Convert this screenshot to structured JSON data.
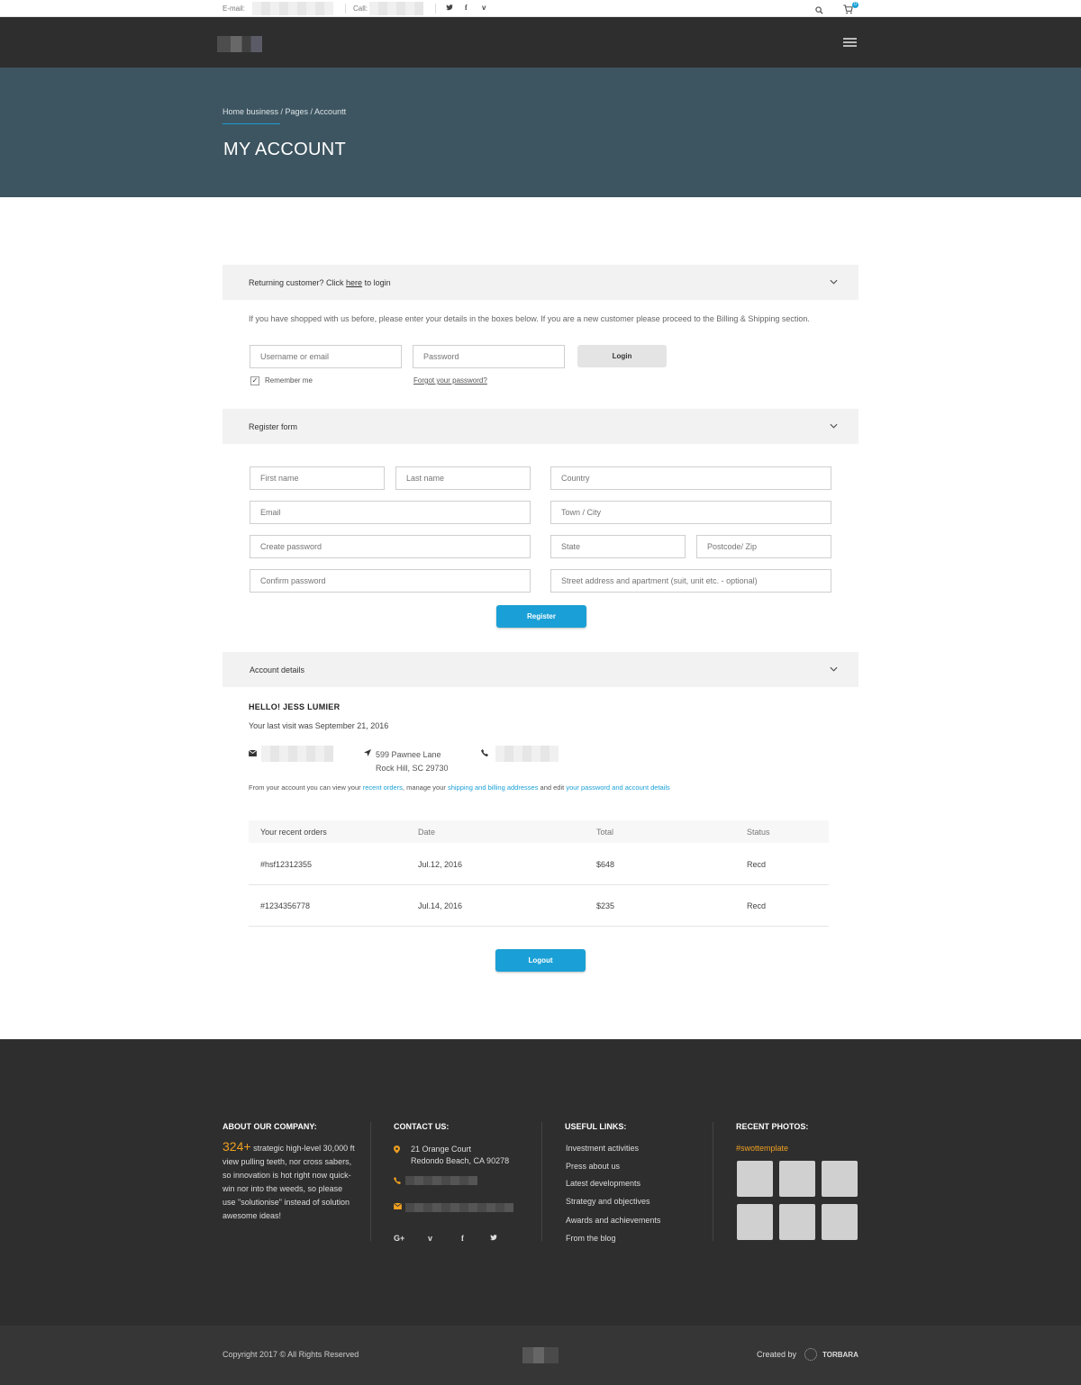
{
  "topbar": {
    "email_label": "E-mail:",
    "call_label": "Call:",
    "social": [
      "twitter-icon",
      "facebook-icon",
      "vimeo-icon"
    ],
    "cart_count": "0"
  },
  "title_band": {
    "breadcrumb": "Home business / Pages / Accountt",
    "title": "MY ACCOUNT"
  },
  "login_section": {
    "header_prefix": "Returning customer?  Click ",
    "header_link": "here",
    "header_suffix": " to login",
    "note": "If you have shopped with us before, please enter your details in the boxes below. If you are a new customer please proceed to the Billing & Shipping section.",
    "username_placeholder": "Username or email",
    "password_placeholder": "Password",
    "login_button": "Login",
    "remember_me": "Remember me",
    "forgot": "Forgot your password?"
  },
  "register_section": {
    "title": "Register form",
    "first_name": "First name",
    "last_name": "Last name",
    "email": "Email",
    "create_password": "Create password",
    "confirm_password": "Confirm password",
    "country": "Country",
    "town": "Town / City",
    "state": "State",
    "postcode": "Postcode/ Zip",
    "street": "Street address and apartment (suit, unit etc. - optional)",
    "register_button": "Register"
  },
  "account_section": {
    "title": "Account details",
    "hello": "HELLO!  JESS LUMIER",
    "last_visit": "Your last visit was September 21, 2016",
    "address_line1": "599 Pawnee Lane",
    "address_line2": "Rock Hill, SC 29730",
    "text_1": "From your account you can view your ",
    "link_1": "recent orders",
    "text_2": ", manage your ",
    "link_2": "shipping and billing addresses",
    "text_3": " and edit ",
    "link_3": "your password and account details",
    "orders_headers": [
      "Your recent orders",
      "Date",
      "Total",
      "Status"
    ],
    "orders": [
      {
        "id": "#hsf12312355",
        "date": "Jul.12, 2016",
        "total": "$648",
        "status": "Recd"
      },
      {
        "id": "#1234356778",
        "date": "Jul.14, 2016",
        "total": "$235",
        "status": "Recd"
      }
    ],
    "logout_button": "Logout"
  },
  "footer": {
    "about_title": "ABOUT OUR COMPANY:",
    "about_number": "324+",
    "about_text_1": "strategic high-level",
    "about_text_2": "30,000 ft view pulling teeth, nor cross sabers, so innovation is hot right now quick-win nor into the weeds, so please use \"solutionise\" instead of solution awesome ideas!",
    "contact_title": "CONTACT US:",
    "contact_address_1": "21 Orange Court",
    "contact_address_2": "Redondo Beach, CA 90278",
    "links_title": "USEFUL LINKS:",
    "links": [
      "Investment activities",
      "Press about us",
      "Latest developments",
      "Strategy and objectives",
      "Awards and achievements",
      "From the blog"
    ],
    "photos_title": "RECENT PHOTOS:",
    "photos_tag": "#swottemplate",
    "copyright": "Copyright 2017  ©  All Rights Reserved",
    "created_by": "Created by",
    "creator": "TORBARA"
  },
  "colors": {
    "accent": "#1aa0d6",
    "title_band": "#3d5560",
    "footer": "#2e2e2e",
    "highlight": "#f0a020"
  }
}
